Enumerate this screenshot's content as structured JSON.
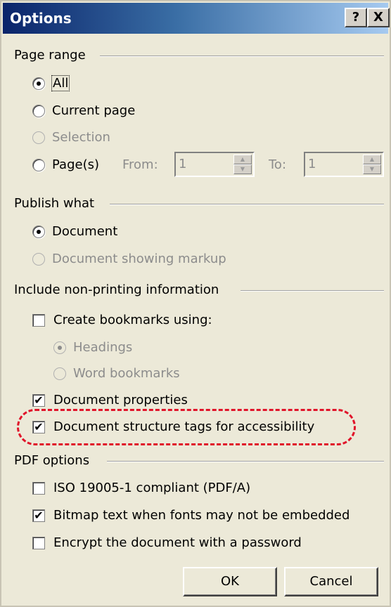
{
  "window": {
    "title": "Options",
    "help_btn": "?",
    "close_btn": "X"
  },
  "page_range": {
    "label": "Page range",
    "all": "All",
    "current_page": "Current page",
    "selection": "Selection",
    "pages": "Page(s)",
    "from_label": "From:",
    "from_value": "1",
    "to_label": "To:",
    "to_value": "1"
  },
  "publish_what": {
    "label": "Publish what",
    "document": "Document",
    "document_markup": "Document showing markup"
  },
  "include_info": {
    "label": "Include non-printing information",
    "create_bookmarks": "Create bookmarks using:",
    "headings": "Headings",
    "word_bookmarks": "Word bookmarks",
    "document_properties": "Document properties",
    "structure_tags": "Document structure tags for accessibility"
  },
  "pdf_options": {
    "label": "PDF options",
    "iso": "ISO 19005-1 compliant (PDF/A)",
    "bitmap": "Bitmap text when fonts may not be embedded",
    "encrypt": "Encrypt the document with a password"
  },
  "buttons": {
    "ok": "OK",
    "cancel": "Cancel"
  },
  "state": {
    "page_range_selected": "All",
    "publish_selected": "Document",
    "bookmark_type_selected": "Headings",
    "create_bookmarks": false,
    "document_properties": true,
    "structure_tags": true,
    "iso": false,
    "bitmap": true,
    "encrypt": false
  },
  "colors": {
    "highlight": "#e0142a",
    "title_bar": "#0a246a"
  }
}
